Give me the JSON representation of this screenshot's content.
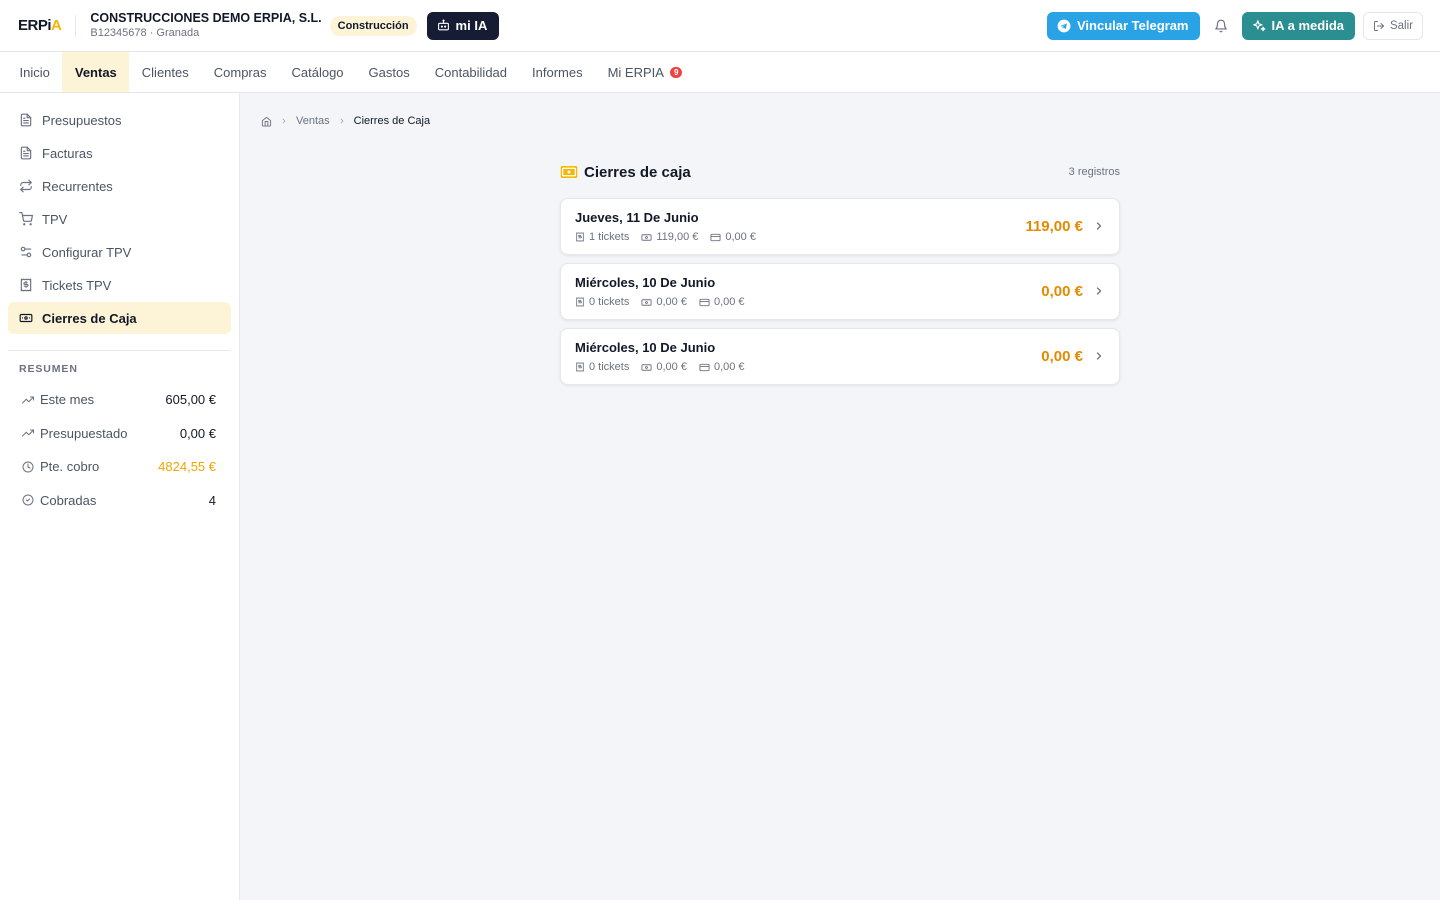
{
  "header": {
    "logo": {
      "erp": "ERP",
      "i": "i",
      "a": "A"
    },
    "company_name": "CONSTRUCCIONES DEMO ERPIA, S.L.",
    "company_sub": "B12345678 · Granada",
    "sector_badge": "Construcción",
    "mi_ia_label": "mi IA",
    "telegram_label": "Vincular Telegram",
    "ia_medida_label": "IA a medida",
    "salir_label": "Salir"
  },
  "nav": {
    "items": [
      {
        "label": "Inicio"
      },
      {
        "label": "Ventas",
        "active": true
      },
      {
        "label": "Clientes"
      },
      {
        "label": "Compras"
      },
      {
        "label": "Catálogo"
      },
      {
        "label": "Gastos"
      },
      {
        "label": "Contabilidad"
      },
      {
        "label": "Informes"
      },
      {
        "label": "Mi ERPIA",
        "badge": "9"
      }
    ]
  },
  "sidebar": {
    "items": [
      {
        "label": "Presupuestos",
        "icon": "document-icon"
      },
      {
        "label": "Facturas",
        "icon": "document-icon"
      },
      {
        "label": "Recurrentes",
        "icon": "repeat-icon"
      },
      {
        "label": "TPV",
        "icon": "cart-icon"
      },
      {
        "label": "Configurar TPV",
        "icon": "settings-sliders-icon"
      },
      {
        "label": "Tickets TPV",
        "icon": "receipt-icon"
      },
      {
        "label": "Cierres de Caja",
        "icon": "cash-icon",
        "active": true
      }
    ],
    "summary_title": "RESUMEN",
    "summary": [
      {
        "label": "Este mes",
        "value": "605,00 €"
      },
      {
        "label": "Presupuestado",
        "value": "0,00 €"
      },
      {
        "label": "Pte. cobro",
        "value": "4824,55 €"
      },
      {
        "label": "Cobradas",
        "value": "4"
      }
    ]
  },
  "breadcrumb": {
    "section": "Ventas",
    "current": "Cierres de Caja"
  },
  "panel": {
    "title": "Cierres de caja",
    "count": "3 registros",
    "accent": "#f5b700",
    "cards": [
      {
        "date": "Jueves, 11 De Junio",
        "tickets": "1 tickets",
        "cash": "119,00 €",
        "card": "0,00 €",
        "total": "119,00 €"
      },
      {
        "date": "Miércoles, 10 De Junio",
        "tickets": "0 tickets",
        "cash": "0,00 €",
        "card": "0,00 €",
        "total": "0,00 €"
      },
      {
        "date": "Miércoles, 10 De Junio",
        "tickets": "0 tickets",
        "cash": "0,00 €",
        "card": "0,00 €",
        "total": "0,00 €"
      }
    ]
  }
}
